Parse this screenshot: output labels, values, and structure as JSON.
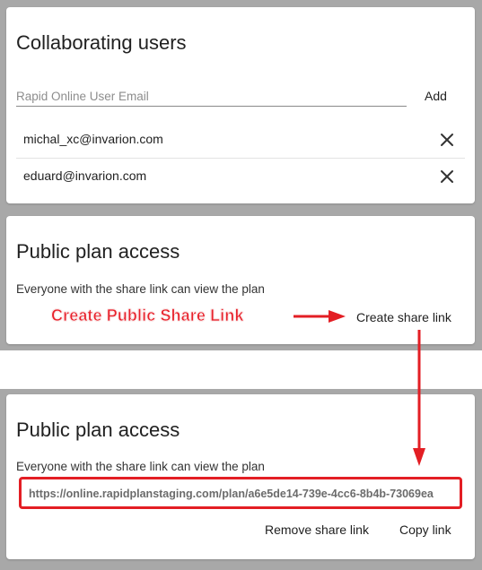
{
  "collab": {
    "title": "Collaborating users",
    "email_placeholder": "Rapid Online User Email",
    "add_label": "Add",
    "users": [
      "michal_xc@invarion.com",
      "eduard@invarion.com"
    ]
  },
  "public_before": {
    "title": "Public plan access",
    "description": "Everyone with the share link can view the plan",
    "create_label": "Create share link"
  },
  "annotation": {
    "label": "Create Public Share Link",
    "color": "#e31e24"
  },
  "public_after": {
    "title": "Public plan access",
    "description": "Everyone with the share link can view the plan",
    "share_link": "https://online.rapidplanstaging.com/plan/a6e5de14-739e-4cc6-8b4b-73069ea",
    "remove_label": "Remove share link",
    "copy_label": "Copy link"
  },
  "icons": {
    "remove_user": "close-icon"
  }
}
